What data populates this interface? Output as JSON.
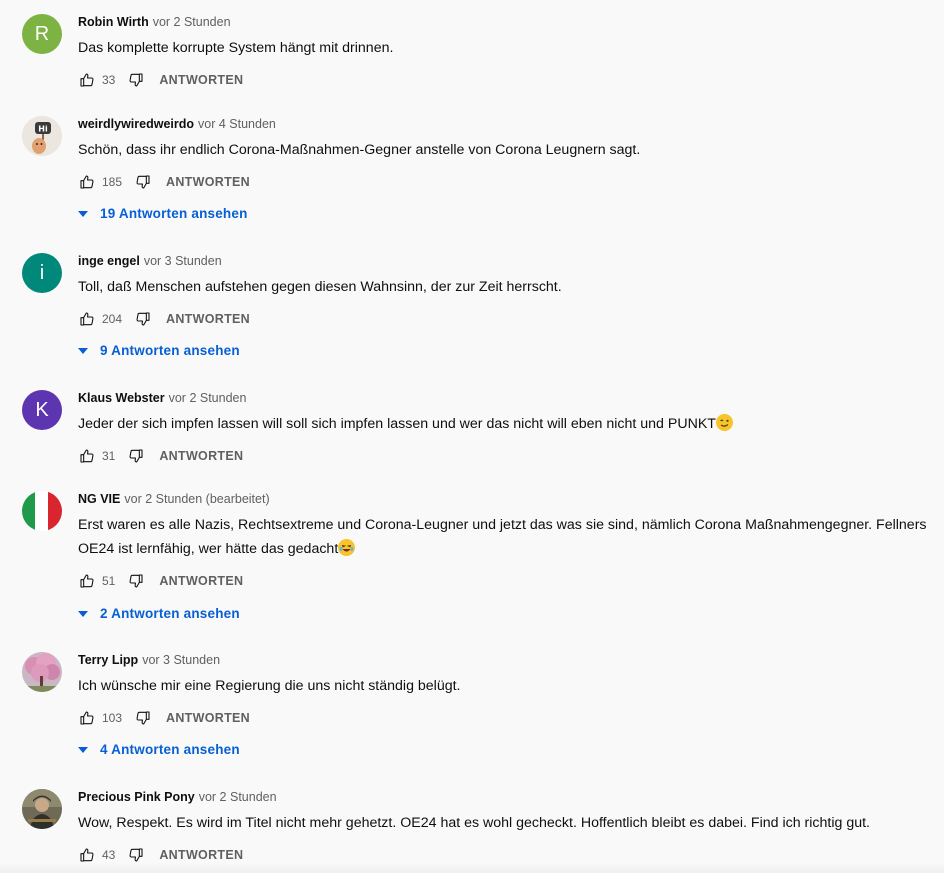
{
  "labels": {
    "reply": "ANTWORTEN"
  },
  "colors": {
    "link": "#065fd4",
    "meta": "#606060",
    "background": "#f9f9f9"
  },
  "comments": [
    {
      "author": "Robin Wirth",
      "time": "vor 2 Stunden",
      "text": "Das komplette korrupte System hängt mit drinnen.",
      "likes": "33",
      "avatar": {
        "type": "letter",
        "letter": "R",
        "color": "#7cb342"
      }
    },
    {
      "author": "weirdlywiredweirdo",
      "time": "vor 4 Stunden",
      "text": "Schön, dass ihr endlich Corona-Maßnahmen-Gegner anstelle von Corona Leugnern sagt.",
      "likes": "185",
      "avatar": {
        "type": "image",
        "icon": "hi-sign-avatar"
      },
      "replies": "19 Antworten ansehen"
    },
    {
      "author": "inge engel",
      "time": "vor 3 Stunden",
      "text": "Toll, daß Menschen aufstehen gegen diesen Wahnsinn, der zur Zeit herrscht.",
      "likes": "204",
      "avatar": {
        "type": "letter",
        "letter": "i",
        "color": "#00897b"
      },
      "replies": "9 Antworten ansehen"
    },
    {
      "author": "Klaus Webster",
      "time": "vor 2 Stunden",
      "text": "Jeder der sich impfen lassen will soll sich impfen lassen und wer das nicht will eben nicht und PUNKT",
      "emoji": "winking-face-emoji",
      "likes": "31",
      "avatar": {
        "type": "letter",
        "letter": "K",
        "color": "#5e35b1"
      }
    },
    {
      "author": "NG VIE",
      "time": "vor 2 Stunden (bearbeitet)",
      "text": "Erst waren es alle Nazis, Rechtsextreme und Corona-Leugner und jetzt das was sie sind, nämlich Corona Maßnahmengegner. Fellners OE24 ist lernfähig, wer hätte das gedacht",
      "emoji": "laughing-face-emoji",
      "likes": "51",
      "avatar": {
        "type": "image",
        "icon": "italian-flag-avatar"
      },
      "replies": "2 Antworten ansehen"
    },
    {
      "author": "Terry Lipp",
      "time": "vor 3 Stunden",
      "text": "Ich wünsche mir eine Regierung die uns nicht ständig belügt.",
      "likes": "103",
      "avatar": {
        "type": "image",
        "icon": "blossom-tree-avatar"
      },
      "replies": "4 Antworten ansehen"
    },
    {
      "author": "Precious Pink Pony",
      "time": "vor 2 Stunden",
      "text": "Wow, Respekt. Es wird im Titel nicht mehr gehetzt. OE24 hat es wohl gecheckt. Hoffentlich bleibt es dabei. Find ich richtig gut.",
      "likes": "43",
      "avatar": {
        "type": "image",
        "icon": "person-photo-avatar"
      }
    }
  ]
}
